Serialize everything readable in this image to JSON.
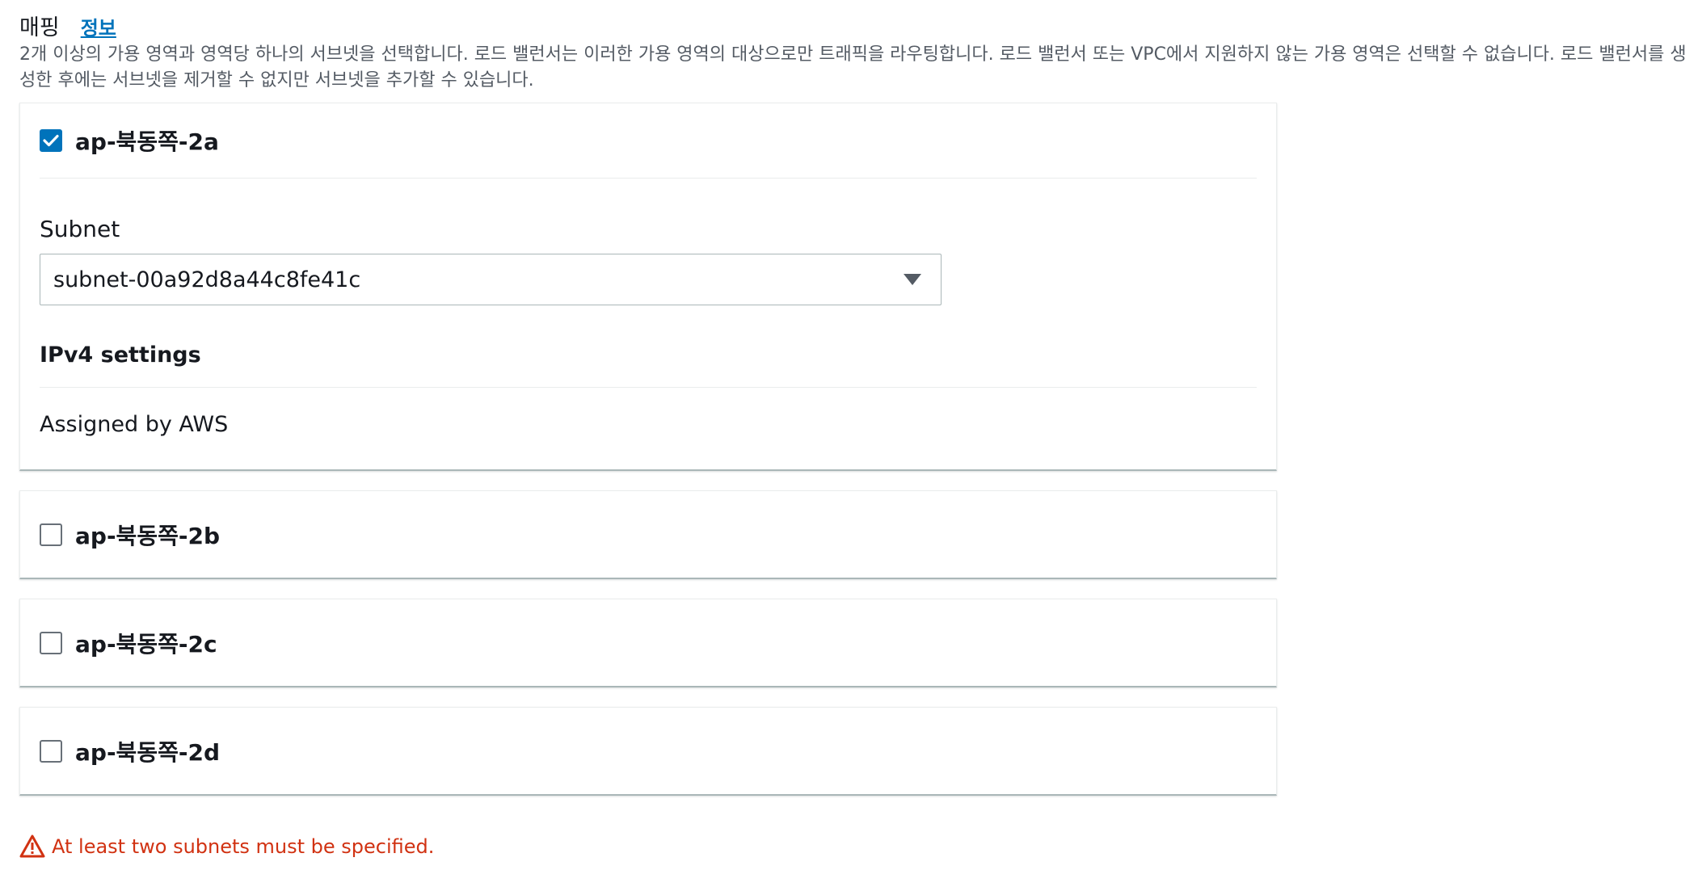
{
  "header": {
    "title": "매핑",
    "info_link": "정보"
  },
  "description": "2개 이상의 가용 영역과 영역당 하나의 서브넷을 선택합니다. 로드 밸런서는 이러한 가용 영역의 대상으로만 트래픽을 라우팅합니다. 로드 밸런서 또는 VPC에서 지원하지 않는 가용 영역은 선택할 수 없습니다. 로드 밸런서를 생성한 후에는 서브넷을 제거할 수 없지만 서브넷을 추가할 수 있습니다.",
  "zones": [
    {
      "name": "ap-북동쪽-2a",
      "checked": true,
      "subnet_label": "Subnet",
      "subnet_value": "subnet-00a92d8a44c8fe41c",
      "ipv4_heading": "IPv4 settings",
      "ipv4_value": "Assigned by AWS"
    },
    {
      "name": "ap-북동쪽-2b",
      "checked": false
    },
    {
      "name": "ap-북동쪽-2c",
      "checked": false
    },
    {
      "name": "ap-북동쪽-2d",
      "checked": false
    }
  ],
  "error": {
    "message": "At least two subnets must be specified.",
    "icon": "warning-triangle-icon"
  },
  "colors": {
    "accent": "#0073bb",
    "error": "#d13212",
    "text": "#16191f",
    "muted": "#545b64"
  }
}
